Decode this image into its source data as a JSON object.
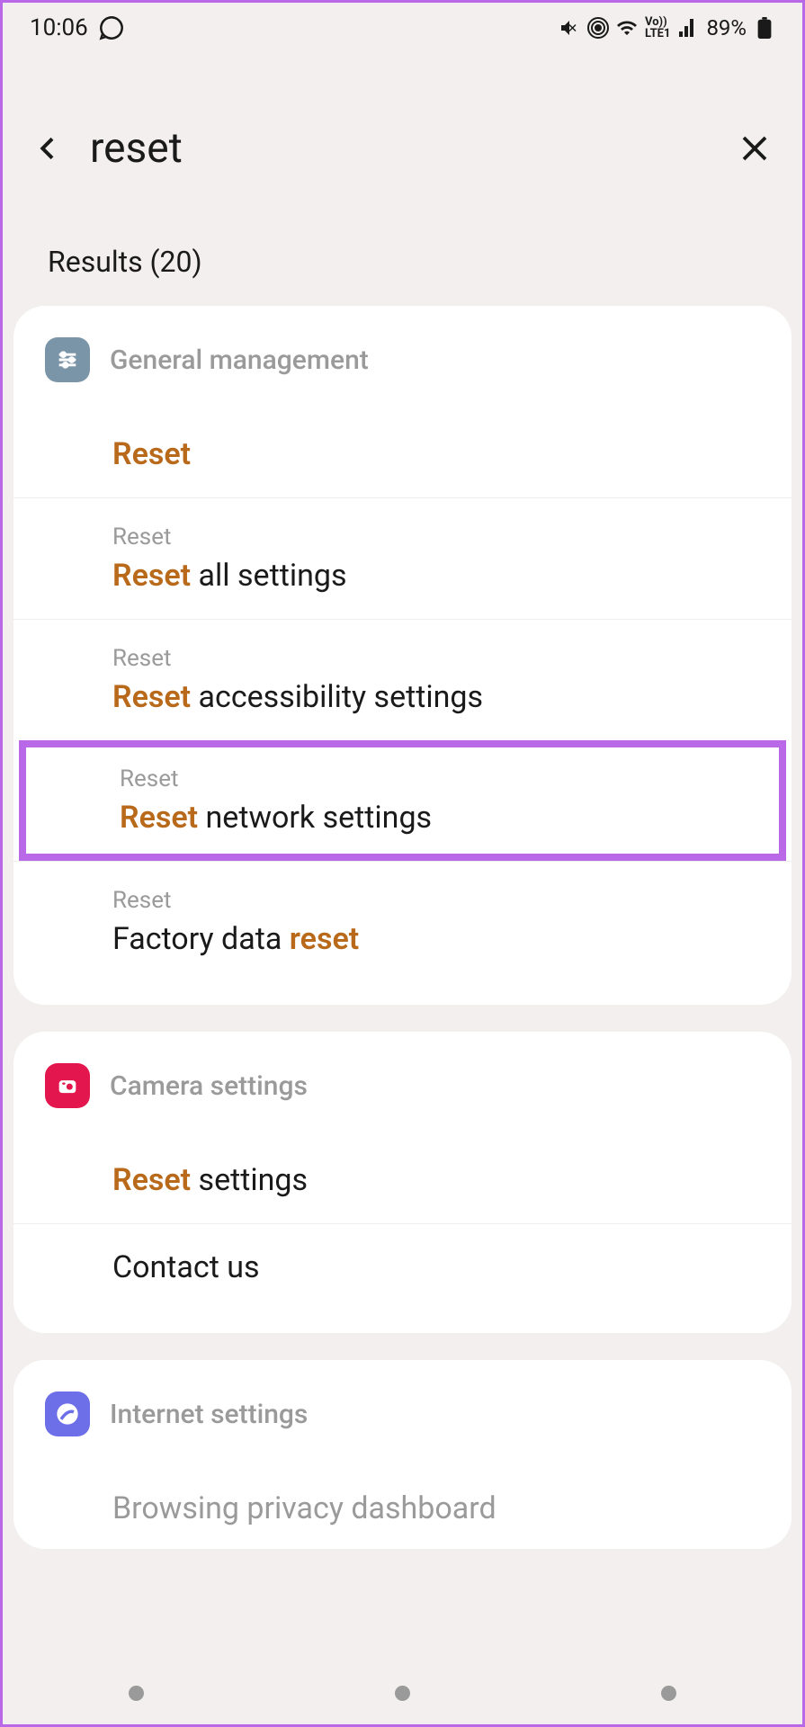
{
  "status_bar": {
    "time": "10:06",
    "battery": "89%"
  },
  "header": {
    "search_query": "reset"
  },
  "results_label": "Results (20)",
  "sections": [
    {
      "title": "General management",
      "items": [
        {
          "breadcrumb": "",
          "prefix_highlight": "Reset",
          "suffix": ""
        },
        {
          "breadcrumb": "Reset",
          "prefix_highlight": "Reset",
          "suffix": " all settings"
        },
        {
          "breadcrumb": "Reset",
          "prefix_highlight": "Reset",
          "suffix": " accessibility settings"
        },
        {
          "breadcrumb": "Reset",
          "prefix_highlight": "Reset",
          "suffix": " network settings"
        },
        {
          "breadcrumb": "Reset",
          "prefix": "Factory data ",
          "suffix_highlight": "reset"
        }
      ]
    },
    {
      "title": "Camera settings",
      "items": [
        {
          "breadcrumb": "",
          "prefix_highlight": "Reset",
          "suffix": " settings"
        },
        {
          "breadcrumb": "",
          "prefix": "Contact us",
          "suffix": ""
        }
      ]
    },
    {
      "title": "Internet settings",
      "items": [
        {
          "breadcrumb": "",
          "prefix": "Browsing privacy dashboard",
          "suffix": ""
        }
      ]
    }
  ]
}
